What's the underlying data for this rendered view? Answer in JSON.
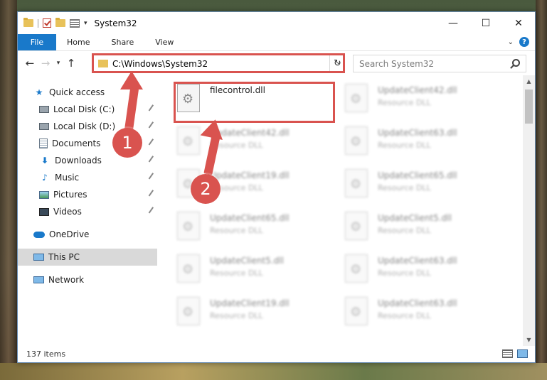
{
  "window": {
    "title": "System32",
    "controls": {
      "minimize": "—",
      "maximize": "☐",
      "close": "✕"
    }
  },
  "ribbon": {
    "file_tab": "File",
    "tabs": [
      "Home",
      "Share",
      "View"
    ]
  },
  "address": {
    "path": "C:\\Windows\\System32",
    "search_placeholder": "Search System32"
  },
  "sidebar": {
    "items": [
      {
        "label": "Quick access",
        "icon": "star-icon"
      },
      {
        "label": "Local Disk (C:)",
        "icon": "disk-icon"
      },
      {
        "label": "Local Disk (D:)",
        "icon": "disk-icon"
      },
      {
        "label": "Documents",
        "icon": "documents-icon"
      },
      {
        "label": "Downloads",
        "icon": "downloads-icon"
      },
      {
        "label": "Music",
        "icon": "music-icon"
      },
      {
        "label": "Pictures",
        "icon": "pictures-icon"
      },
      {
        "label": "Videos",
        "icon": "videos-icon"
      },
      {
        "label": "OneDrive",
        "icon": "cloud-icon"
      },
      {
        "label": "This PC",
        "icon": "pc-icon"
      },
      {
        "label": "Network",
        "icon": "network-icon"
      }
    ]
  },
  "files": [
    {
      "name": "filecontrol.dll",
      "type": ""
    },
    {
      "name": "UpdateClient42.dll",
      "type": "Resource DLL"
    },
    {
      "name": "UpdateClient42.dll",
      "type": "Resource DLL"
    },
    {
      "name": "UpdateClient63.dll",
      "type": "Resource DLL"
    },
    {
      "name": "UpdateClient19.dll",
      "type": "Resource DLL"
    },
    {
      "name": "UpdateClient65.dll",
      "type": "Resource DLL"
    },
    {
      "name": "UpdateClient65.dll",
      "type": "Resource DLL"
    },
    {
      "name": "UpdateClient5.dll",
      "type": "Resource DLL"
    },
    {
      "name": "UpdateClient5.dll",
      "type": "Resource DLL"
    },
    {
      "name": "UpdateClient63.dll",
      "type": "Resource DLL"
    },
    {
      "name": "UpdateClient19.dll",
      "type": "Resource DLL"
    },
    {
      "name": "UpdateClient63.dll",
      "type": "Resource DLL"
    }
  ],
  "status": {
    "item_count": "137 items"
  },
  "annotations": {
    "badge1": "1",
    "badge2": "2"
  },
  "colors": {
    "accent": "#1979ca",
    "highlight": "#d9534f"
  }
}
